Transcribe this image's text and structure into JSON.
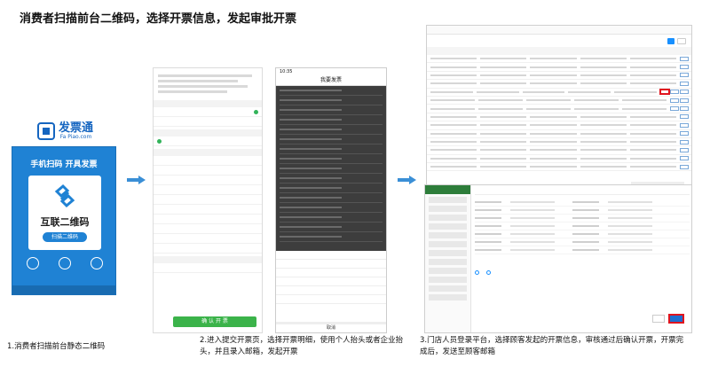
{
  "headline": "消费者扫描前台二维码，选择开票信息，发起审批开票",
  "poster": {
    "brand_name": "发票通",
    "brand_domain": "Fa Piao.com",
    "slogan": "手机扫码 开具发票",
    "card_title": "互联二维码",
    "card_button": "扫描二维码"
  },
  "form": {
    "submit_label": "确 认 开 票"
  },
  "phone": {
    "time": "10:35",
    "title": "我要发票",
    "cancel": "取消"
  },
  "captions": {
    "step1": "1.消费者扫描前台静态二维码",
    "step2": "2.进入提交开票页，选择开票明细，使用个人抬头或者企业抬头，并且录入邮箱，发起开票",
    "step3": "3.门店人员登录平台，选择顾客发起的开票信息，审核通过后确认开票，开票完成后，发送至顾客邮箱"
  },
  "colors": {
    "brand_blue": "#1f82d4",
    "confirm_green": "#3bb34a",
    "highlight_red": "#e0141e"
  }
}
